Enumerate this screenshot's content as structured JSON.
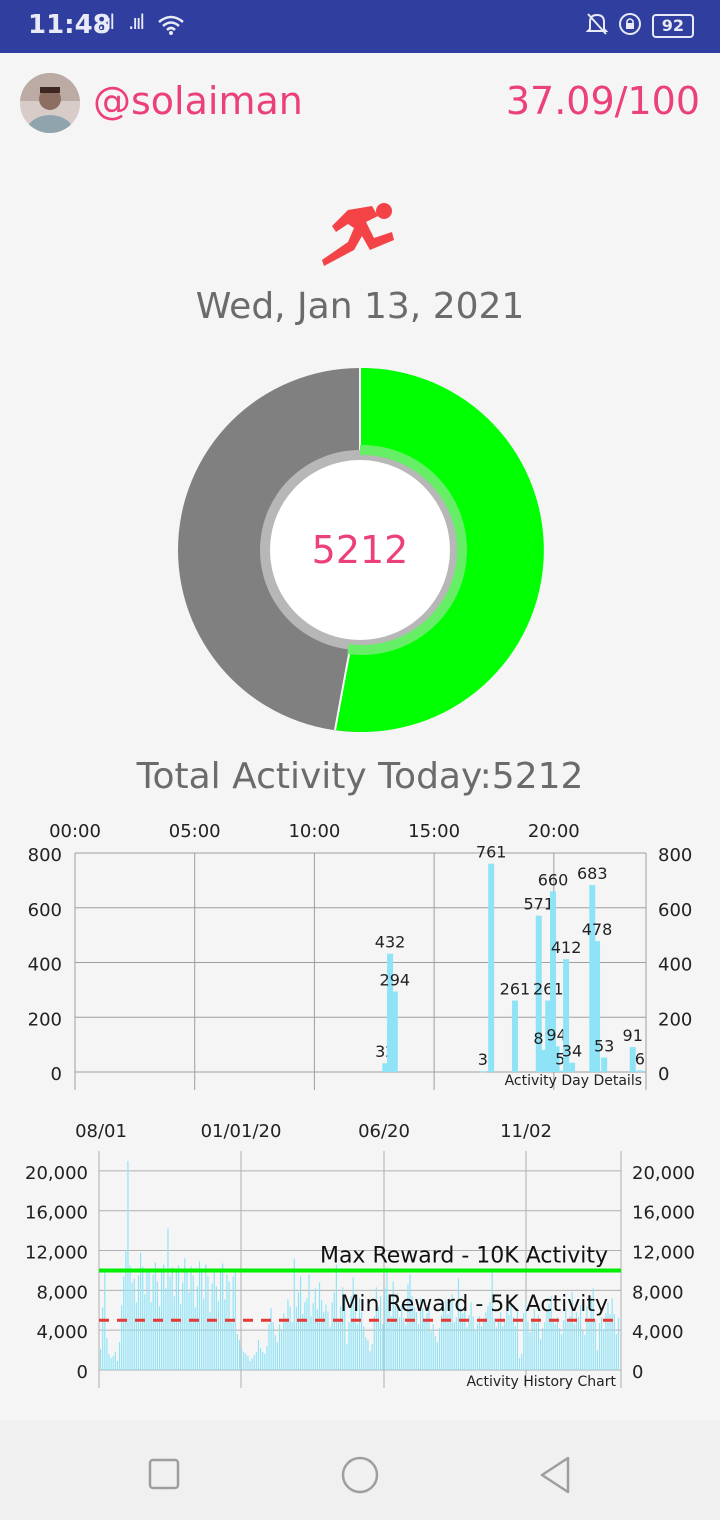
{
  "status_bar": {
    "time": "11:48",
    "signal_1": ".ııl",
    "signal_2": ".ııl",
    "battery": "92"
  },
  "header": {
    "username": "@solaiman",
    "score": "37.09/100"
  },
  "activity": {
    "date": "Wed, Jan 13, 2021",
    "today_value": "5212",
    "total_label": "Total Activity Today:5212"
  },
  "colors": {
    "accent_pink": "#ec407a",
    "donut_done": "#00ff00",
    "donut_remaining": "#808080",
    "bar_color": "#8ee4f6",
    "status_bar": "#303f9f",
    "max_line": "#00ee00",
    "min_line": "#e53935"
  },
  "chart_data": [
    {
      "type": "bar",
      "description_label": "Activity Day Details",
      "x_ticks": [
        "00:00",
        "05:00",
        "10:00",
        "15:00",
        "20:00"
      ],
      "ylim": [
        0,
        800
      ],
      "y_ticks": [
        "0",
        "200",
        "400",
        "600",
        "800"
      ],
      "points": [
        {
          "hour": 13.0,
          "value": 32,
          "label": "32"
        },
        {
          "hour": 13.2,
          "value": 432,
          "label": "432"
        },
        {
          "hour": 13.4,
          "value": 294,
          "label": "294"
        },
        {
          "hour": 17.1,
          "value": 3,
          "label": "3"
        },
        {
          "hour": 17.45,
          "value": 761,
          "label": "761"
        },
        {
          "hour": 18.45,
          "value": 261,
          "label": "261"
        },
        {
          "hour": 19.45,
          "value": 571,
          "label": "571"
        },
        {
          "hour": 19.65,
          "value": 81,
          "label": "81"
        },
        {
          "hour": 19.85,
          "value": 261,
          "label": "261"
        },
        {
          "hour": 20.05,
          "value": 660,
          "label": "660"
        },
        {
          "hour": 20.2,
          "value": 94,
          "label": "94"
        },
        {
          "hour": 20.35,
          "value": 5,
          "label": "5"
        },
        {
          "hour": 20.6,
          "value": 412,
          "label": "412"
        },
        {
          "hour": 20.85,
          "value": 34,
          "label": "34"
        },
        {
          "hour": 21.7,
          "value": 683,
          "label": "683"
        },
        {
          "hour": 21.9,
          "value": 478,
          "label": "478"
        },
        {
          "hour": 22.2,
          "value": 53,
          "label": "53"
        },
        {
          "hour": 23.4,
          "value": 91,
          "label": "91"
        },
        {
          "hour": 23.7,
          "value": 6,
          "label": "6"
        }
      ]
    },
    {
      "type": "bar",
      "description_label": "Activity History Chart",
      "x_ticks": [
        "08/01",
        "01/01/20",
        "06/20",
        "11/02"
      ],
      "ylim": [
        0,
        22000
      ],
      "y_ticks": [
        "0",
        "4,000",
        "8,000",
        "12,000",
        "16,000",
        "20,000"
      ],
      "max_line": {
        "value": 10000,
        "label": "Max Reward - 10K Activity"
      },
      "min_line": {
        "value": 5000,
        "label": "Min Reward - 5K Activity"
      },
      "values": [
        2100,
        6300,
        9800,
        3200,
        1600,
        1200,
        1400,
        1800,
        900,
        2800,
        6500,
        9400,
        12000,
        21000,
        10500,
        8800,
        9200,
        6800,
        9500,
        11800,
        10400,
        7600,
        9900,
        10200,
        6800,
        9600,
        10800,
        8900,
        6400,
        9800,
        10600,
        8200,
        14200,
        9400,
        10300,
        7400,
        9900,
        10500,
        6600,
        8800,
        11200,
        10100,
        7800,
        10400,
        9500,
        6300,
        8400,
        10900,
        9900,
        7200,
        10600,
        9400,
        5800,
        8700,
        10200,
        8400,
        6900,
        9800,
        10700,
        7100,
        9600,
        8900,
        4800,
        9400,
        10000,
        3600,
        3000,
        2200,
        1800,
        1600,
        1400,
        900,
        1200,
        1500,
        1800,
        3000,
        2200,
        1800,
        1600,
        2400,
        4600,
        6200,
        4800,
        3500,
        2800,
        4600,
        3900,
        5700,
        5200,
        7100,
        6400,
        4800,
        11200,
        6300,
        7800,
        9400,
        5600,
        6800,
        7200,
        9600,
        5400,
        6700,
        8200,
        6100,
        8800,
        7000,
        5800,
        6600,
        5900,
        4300,
        6800,
        7800,
        10600,
        5200,
        6400,
        8300,
        7600,
        2600,
        4800,
        7400,
        9300,
        6400,
        4600,
        7200,
        5800,
        4400,
        3300,
        3000,
        1900,
        2600,
        5400,
        8300,
        6400,
        7400,
        4600,
        8200,
        10300,
        7200,
        5400,
        8900,
        6400,
        7700,
        5300,
        6600,
        5200,
        4500,
        8600,
        9600,
        7400,
        6300,
        5800,
        4600,
        7200,
        6200,
        4900,
        5700,
        6400,
        3900,
        4600,
        3400,
        2800,
        4200,
        5500,
        6300,
        7100,
        5600,
        6900,
        7600,
        4800,
        5300,
        9200,
        6200,
        5700,
        6400,
        4300,
        5500,
        6800,
        5400,
        3900,
        4600,
        5400,
        4400,
        5200,
        5800,
        6400,
        6800,
        9800,
        5200,
        4300,
        5000,
        5800,
        4400,
        4900,
        6300,
        5500,
        7100,
        5300,
        4400,
        6200,
        1200,
        1600,
        5700,
        6800,
        4900,
        3800,
        5200,
        6100,
        4700,
        5500,
        3100,
        4200,
        4800,
        5900,
        6600,
        7400,
        5200,
        4600,
        5300,
        4200,
        3600,
        5000,
        6200,
        4800,
        5400,
        7800,
        4600,
        5800,
        5300,
        6500,
        4000,
        3500,
        6400,
        5200,
        7300,
        8200,
        4900,
        2000,
        4700,
        5300,
        4100,
        5700,
        6800,
        5600,
        7200,
        5600,
        3600,
        5212
      ]
    }
  ]
}
